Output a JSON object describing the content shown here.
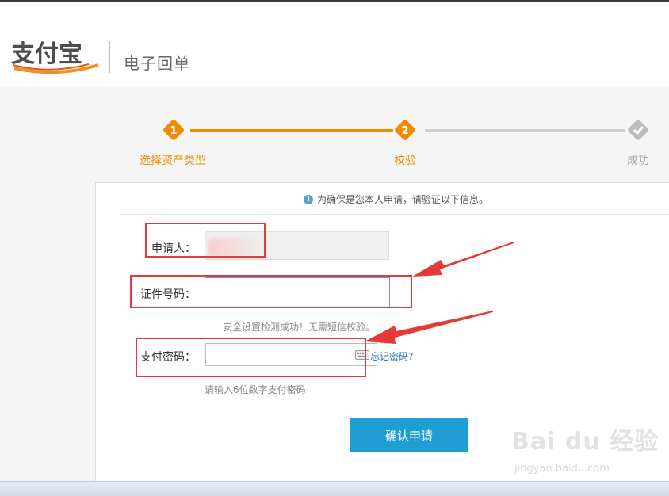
{
  "header": {
    "logo_text": "支付宝",
    "title": "电子回单"
  },
  "steps": [
    {
      "number": "1",
      "label": "选择资产类型",
      "state": "done"
    },
    {
      "number": "2",
      "label": "校验",
      "state": "current"
    },
    {
      "number": "",
      "label": "成功",
      "state": "todo"
    }
  ],
  "form": {
    "notice": "为确保是您本人申请，请验证以下信息。",
    "applicant_label": "申请人：",
    "id_label": "证件号码：",
    "id_value": "",
    "security_hint": "安全设置检测成功！无需短信校验。",
    "password_label": "支付密码：",
    "password_value": "",
    "forgot_link": "忘记密码?",
    "password_hint": "请输入6位数字支付密码",
    "submit_label": "确认申请"
  },
  "watermark": {
    "brand": "Bai du 经验",
    "url": "jingyan.baidu.com"
  },
  "colors": {
    "accent_orange": "#f08c00",
    "button_blue": "#1e9ed3",
    "link_blue": "#1a6fb5",
    "annotation_red": "#e53935"
  }
}
